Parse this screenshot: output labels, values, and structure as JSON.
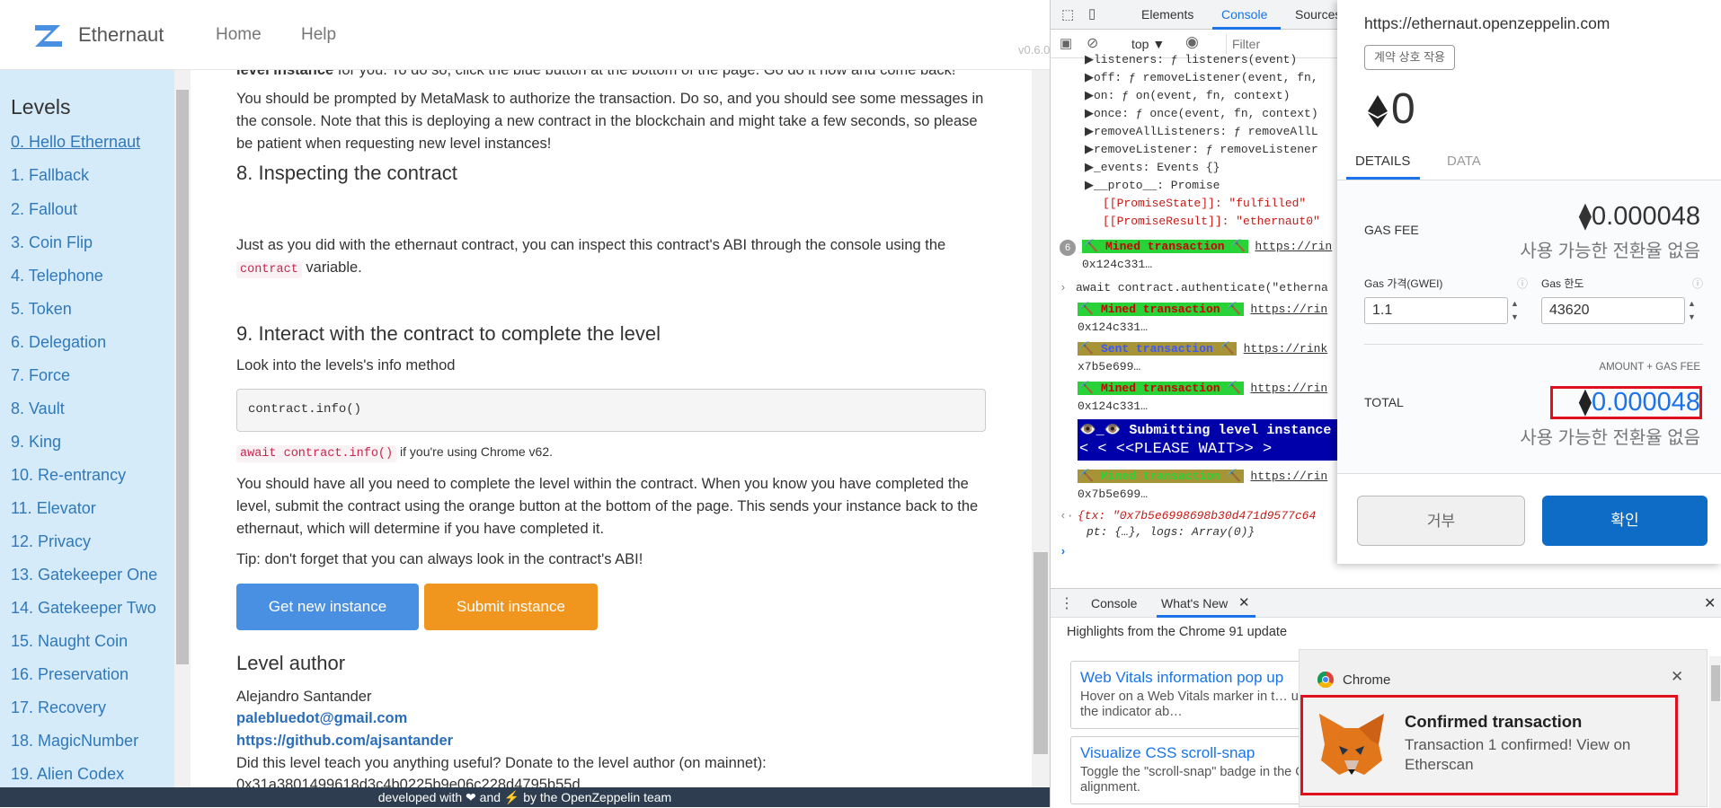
{
  "ethernaut": {
    "brand": "Ethernaut",
    "nav": [
      "Home",
      "Help"
    ],
    "version": "v0.6.0",
    "sidebar_title": "Levels",
    "levels": [
      "0. Hello Ethernaut",
      "1. Fallback",
      "2. Fallout",
      "3. Coin Flip",
      "4. Telephone",
      "5. Token",
      "6. Delegation",
      "7. Force",
      "8. Vault",
      "9. King",
      "10. Re-entrancy",
      "11. Elevator",
      "12. Privacy",
      "13. Gatekeeper One",
      "14. Gatekeeper Two",
      "15. Naught Coin",
      "16. Preservation",
      "17. Recovery",
      "18. MagicNumber",
      "19. Alien Codex"
    ],
    "content": {
      "cut_top_bold": "level instance",
      "cut_top_rest": " for you. To do so, click the blue button at the bottom of the page. Go do it now and come back!",
      "p_metamask": "You should be prompted by MetaMask to authorize the transaction. Do so, and you should see some messages in the console. Note that this is deploying a new contract in the blockchain and might take a few seconds, so please be patient when requesting new level instances!",
      "h_inspect": "8. Inspecting the contract",
      "p_inspect_a": "Just as you did with the ethernaut contract, you can inspect this contract's ABI through the console using the",
      "p_inspect_code": "contract",
      "p_inspect_b": " variable.",
      "h_interact": "9. Interact with the contract to complete the level",
      "p_look": "Look into the levels's info method",
      "codeblock": "contract.info()",
      "await_code": "await contract.info()",
      "await_rest": " if you're using Chrome v62.",
      "p_complete": "You should have all you need to complete the level within the contract. When you know you have completed the level, submit the contract using the orange button at the bottom of the page. This sends your instance back to the ethernaut, which will determine if you have completed it.",
      "p_tip": "Tip: don't forget that you can always look in the contract's ABI!",
      "btn_new": "Get new instance",
      "btn_submit": "Submit instance",
      "h_author": "Level author",
      "author_name": "Alejandro Santander",
      "author_email": "palebluedot@gmail.com",
      "author_github": "https://github.com/ajsantander",
      "donate": "Did this level teach you anything useful? Donate to the level author (on mainnet):",
      "address": "0x31a3801499618d3c4b0225b9e06c228d4795b55d"
    },
    "footer": "developed with ❤ and ⚡ by the OpenZeppelin team"
  },
  "devtools": {
    "tabs": [
      "Elements",
      "Console",
      "Sources"
    ],
    "context": "top ▼",
    "filter_placeholder": "Filter",
    "lines": [
      "▶listeners: ƒ listeners(event)",
      "▶off: ƒ removeListener(event, fn,",
      "▶on: ƒ on(event, fn, context)",
      "▶once: ƒ once(event, fn, context)",
      "▶removeAllListeners: ƒ removeAllL",
      "▶removeListener: ƒ removeListener",
      "▶_events: Events {}",
      "▶__proto__: Promise",
      "[[PromiseState]]: \"fulfilled\"",
      "[[PromiseResult]]: \"ethernaut0\""
    ],
    "count_badge": "6",
    "mined_label": "⛏️ Mined transaction ⛏️",
    "sent_label": "⛏️ Sent transaction ⛏️",
    "url_stub": "https://rin",
    "url_stub2": "https://rink",
    "hash1": "0x124c331…",
    "hash2": "x7b5e699…",
    "hash3": "0x7b5e699…",
    "await_line": "await contract.authenticate(\"etherna",
    "submitting": "👁️_👁️ Submitting level instance",
    "please_wait": "<  < <<PLEASE WAIT>> >",
    "tx_line1": "{tx: \"0x7b5e6998698b30d471d9577c64",
    "tx_line2": "pt: {…}, logs: Array(0)}",
    "drawer_tabs": [
      "Console",
      "What's New"
    ],
    "highlights": "Highlights from the Chrome 91 update",
    "cards": [
      {
        "title": "Web Vitals information pop up",
        "desc": "Hover on a Web Vitals marker in t… understand what's the indicator ab…"
      },
      {
        "title": "Visualize CSS scroll-snap",
        "desc": "Toggle the \"scroll-snap\" badge in the CSS scroll-snap alignment."
      }
    ]
  },
  "metamask": {
    "origin": "https://ethernaut.openzeppelin.com",
    "badge": "계약 상호 작용",
    "balance": "0",
    "tabs": [
      "DETAILS",
      "DATA"
    ],
    "gas_fee_label": "GAS FEE",
    "gas_fee_value": "0.000048",
    "no_conversion": "사용 가능한 전환율 없음",
    "gas_price_label": "Gas 가격(GWEI)",
    "gas_limit_label": "Gas 한도",
    "gas_price_value": "1.1",
    "gas_limit_value": "43620",
    "amount_gas_label": "AMOUNT + GAS FEE",
    "total_label": "TOTAL",
    "total_value": "0.000048",
    "reject": "거부",
    "confirm": "확인"
  },
  "notification": {
    "app": "Chrome",
    "title": "Confirmed transaction",
    "body": "Transaction 1 confirmed! View on Etherscan"
  },
  "colors": {
    "accent_blue": "#4a90e2",
    "accent_orange": "#f0961f",
    "metamask_confirm": "#0f6cc6",
    "highlight_red": "#e1101f",
    "sidebar_bg": "#d6ebfa"
  }
}
